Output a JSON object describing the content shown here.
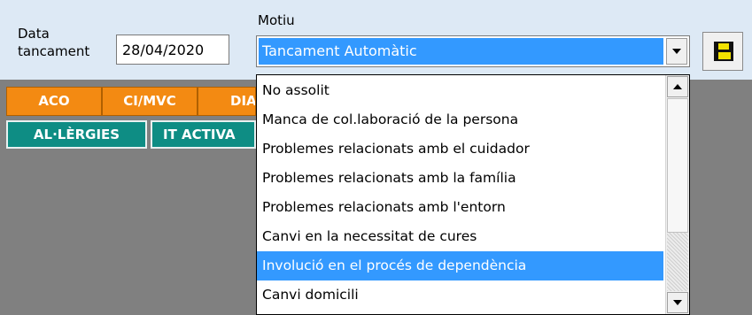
{
  "form": {
    "close_date_label": "Data\ntancament",
    "close_date_value": "28/04/2020",
    "reason_label": "Motiu",
    "reason_selected": "Tancament Automàtic"
  },
  "tabs_row1": [
    "ACO",
    "CI/MVC",
    "DIA"
  ],
  "tabs_row2": [
    "AL·LÈRGIES",
    "IT ACTIVA"
  ],
  "dropdown": {
    "options": [
      "No assolit",
      "Manca de col.laboració de la persona",
      "Problemes relacionats amb el cuidador",
      "Problemes relacionats amb la família",
      "Problemes relacionats amb l'entorn",
      "Canvi en la necessitat de cures",
      "Involució en el procés de dependència",
      "Canvi domicili"
    ],
    "highlighted_index": 6
  },
  "colors": {
    "panel_bg": "#dde9f5",
    "selection_blue": "#3399ff",
    "tab_orange": "#f38a12",
    "tab_teal": "#0e8d84",
    "background_gray": "#808080"
  },
  "icons": {
    "save": "floppy-disk-icon",
    "combo_arrow": "chevron-down-icon",
    "scroll_up": "scroll-up-arrow-icon",
    "scroll_down": "scroll-down-arrow-icon"
  }
}
